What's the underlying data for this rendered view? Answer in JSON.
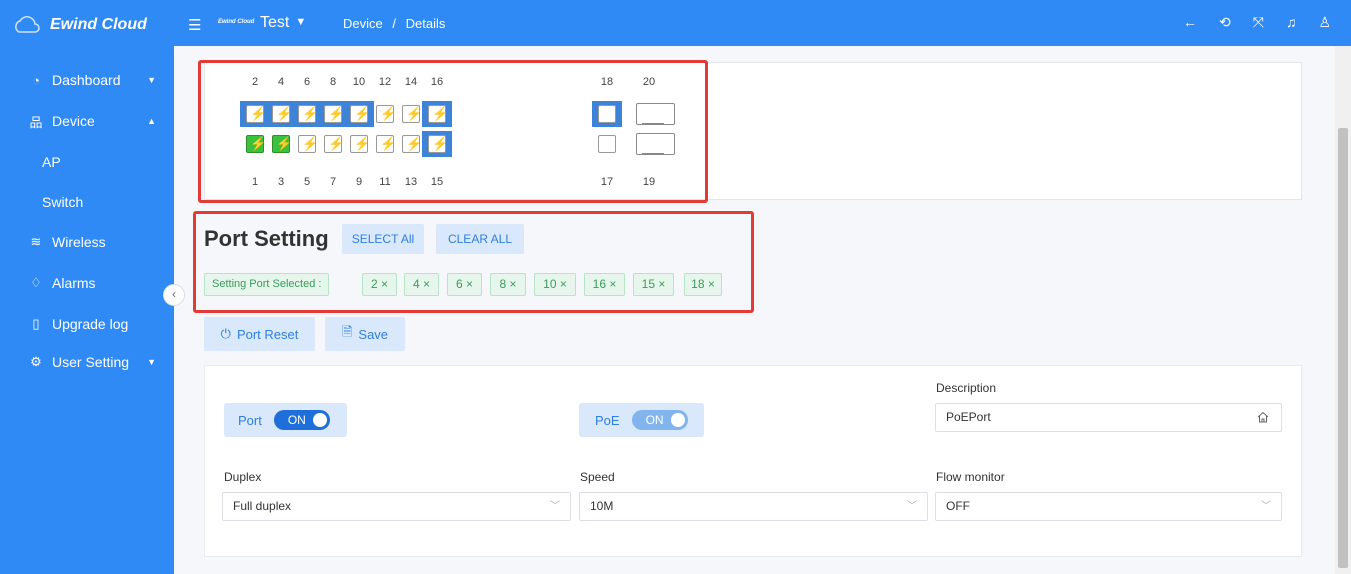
{
  "app": {
    "name": "Ewind Cloud",
    "brand_small": "Ewind Cloud"
  },
  "header": {
    "project": "Test",
    "breadcrumb": [
      "Device",
      "Details"
    ],
    "breadcrumb_sep": "/",
    "icons": [
      "back-arrow-icon",
      "refresh-icon",
      "fullscreen-icon",
      "notification-icon",
      "user-icon"
    ]
  },
  "sidebar": {
    "items": [
      {
        "label": "Dashboard",
        "icon": "dashboard-icon",
        "caret": "down"
      },
      {
        "label": "Device",
        "icon": "device-icon",
        "caret": "up"
      },
      {
        "label": "AP",
        "sub": true
      },
      {
        "label": "Switch",
        "sub": true
      },
      {
        "label": "Wireless",
        "icon": "wifi-icon"
      },
      {
        "label": "Alarms",
        "icon": "bell-icon"
      },
      {
        "label": "Upgrade log",
        "icon": "document-icon"
      },
      {
        "label": "User Setting",
        "icon": "gear-icon",
        "caret": "down"
      }
    ]
  },
  "ports": {
    "top": [
      {
        "num": "2",
        "selected": true,
        "poe": "yellow"
      },
      {
        "num": "4",
        "selected": true,
        "poe": "red"
      },
      {
        "num": "6",
        "selected": true,
        "poe": "red"
      },
      {
        "num": "8",
        "selected": true,
        "poe": "red"
      },
      {
        "num": "10",
        "selected": true,
        "poe": "red"
      },
      {
        "num": "12",
        "selected": false,
        "poe": "red"
      },
      {
        "num": "14",
        "selected": false,
        "poe": "red"
      },
      {
        "num": "16",
        "selected": true,
        "poe": "yellow"
      },
      {
        "num": "18",
        "selected": true,
        "poe": "none"
      },
      {
        "num": "20",
        "selected": false,
        "poe": "sfp"
      }
    ],
    "bottom": [
      {
        "num": "1",
        "selected": false,
        "poe": "yellow",
        "link": "green"
      },
      {
        "num": "3",
        "selected": false,
        "poe": "yellow",
        "link": "green"
      },
      {
        "num": "5",
        "selected": false,
        "poe": "red"
      },
      {
        "num": "7",
        "selected": false,
        "poe": "red"
      },
      {
        "num": "9",
        "selected": false,
        "poe": "red"
      },
      {
        "num": "11",
        "selected": false,
        "poe": "red"
      },
      {
        "num": "13",
        "selected": false,
        "poe": "red"
      },
      {
        "num": "15",
        "selected": true,
        "poe": "red"
      },
      {
        "num": "17",
        "selected": false,
        "poe": "none"
      },
      {
        "num": "19",
        "selected": false,
        "poe": "sfp"
      }
    ]
  },
  "port_setting": {
    "title": "Port Setting",
    "select_all": "SELECT All",
    "clear_all": "CLEAR ALL",
    "selected_label": "Setting Port Selected :",
    "selected_tags": [
      "2 ×",
      "4 ×",
      "6 ×",
      "8 ×",
      "10 ×",
      "16 ×",
      "15 ×",
      "18 ×"
    ]
  },
  "actions": {
    "port_reset": "Port Reset",
    "save": "Save"
  },
  "form": {
    "port_label": "Port",
    "port_toggle": "ON",
    "poe_label": "PoE",
    "poe_toggle": "ON",
    "description_label": "Description",
    "description_value": "PoEPort",
    "duplex_label": "Duplex",
    "duplex_value": "Full duplex",
    "speed_label": "Speed",
    "speed_value": "10M",
    "flow_label": "Flow monitor",
    "flow_value": "OFF"
  },
  "colors": {
    "primary": "#2f8af5",
    "selected_port": "#3d84d8",
    "highlight": "#e53935",
    "tag_green": "#3a9c5a"
  }
}
